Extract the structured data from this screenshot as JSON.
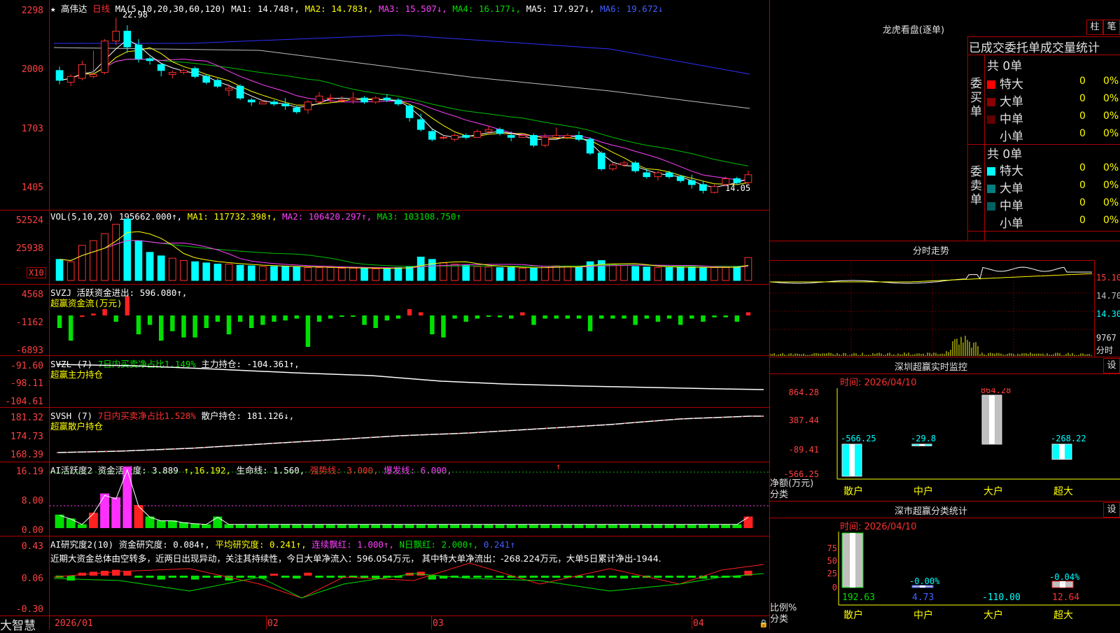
{
  "app": {
    "brand": "大智慧",
    "date_labels": [
      "2026/01",
      "02",
      "03",
      "04"
    ]
  },
  "chart_header": {
    "stock": "★ 高伟达",
    "period": "日线",
    "ma_params": "MA(5,10,20,30,60,120)",
    "ma1": "MA1: 14.748↑,",
    "ma2": "MA2: 14.783↑,",
    "ma3": "MA3: 15.507↓,",
    "ma4": "MA4: 16.177↓,",
    "ma5": "MA5: 17.927↓,",
    "ma6": "MA6: 19.672↓",
    "high_mark": "22.98",
    "low_mark": "14.05",
    "y_labels": [
      "2298",
      "2000",
      "1703",
      "1405"
    ]
  },
  "vol_panel": {
    "header_name": "VOL(5,10,20)",
    "header_value": "195662.000↑,",
    "ma1": "MA1: 117732.398↑,",
    "ma2": "MA2: 106420.297↑,",
    "ma3": "MA3: 103108.750↑",
    "y_labels": [
      "52524",
      "25938"
    ],
    "unit": "X10"
  },
  "svzj_panel": {
    "name": "SVZJ",
    "title": "活跃资金进出: 596.080↑,",
    "sub": "超赢资金流(万元)",
    "y_labels": [
      "4568",
      "-1162",
      "-6893"
    ]
  },
  "svzl_panel": {
    "name": "SVZL (7)",
    "t1": "7日内买卖净占比1.149%",
    "t2": "主力持仓: -104.361↑,",
    "sub": "超赢主力持仓",
    "y_labels": [
      "-91.60",
      "-98.11",
      "-104.61"
    ]
  },
  "svsh_panel": {
    "name": "SVSH (7)",
    "t1": "7日内买卖净占比1.528%",
    "t2": "散户持仓: 181.126↓,",
    "sub": "超赢散户持仓",
    "y_labels": [
      "181.32",
      "174.73",
      "168.39"
    ]
  },
  "ai_active": {
    "name": "AI活跃度2",
    "t1": "资金活跃度: 3.889",
    "t2": "↑,16.192,",
    "t3": "生命线: 1.560,",
    "t4": "强势线: 3.000,",
    "t5": "爆发线: 6.000,",
    "arrow": "↑",
    "y_labels": [
      "16.19",
      "8.00",
      "0.00"
    ]
  },
  "ai_research": {
    "name": "AI研究度2(10)",
    "t1": "资金研究度: 0.084↑,",
    "t2": "平均研究度: 0.241↑,",
    "t3": "连续飘红: 1.000↑,",
    "t4": "N日飘红: 2.000↑,",
    "t5": "0.241↑",
    "comment": "近期大资金总体由空转多，近两日出现异动，关注其持续性，今日大单净流入：596.054万元， 其中特大单净流出：-268.224万元，大单5日累计净出-1944.",
    "y_labels": [
      "0.43",
      "0.06",
      "-0.30"
    ]
  },
  "dragon_tiger": {
    "title": "龙虎看盘(逐单)",
    "btn1": "柱",
    "btn2": "笔",
    "stats_title": "已成交委托单成交量统计",
    "buy_label": "委买单",
    "sell_label": "委卖单",
    "buy_total": "共 0单",
    "sell_total": "共 0单",
    "buy_rows": [
      {
        "label": "特大",
        "value": "0",
        "pct": "0%",
        "color": "#ff0000"
      },
      {
        "label": "大单",
        "value": "0",
        "pct": "0%",
        "color": "#8b0000"
      },
      {
        "label": "中单",
        "value": "0",
        "pct": "0%",
        "color": "#600000"
      },
      {
        "label": "小单",
        "value": "0",
        "pct": "0%",
        "color": ""
      }
    ],
    "sell_rows": [
      {
        "label": "特大",
        "value": "0",
        "pct": "0%",
        "color": "#00ffff"
      },
      {
        "label": "大单",
        "value": "0",
        "pct": "0%",
        "color": "#008080"
      },
      {
        "label": "中单",
        "value": "0",
        "pct": "0%",
        "color": "#006060"
      },
      {
        "label": "小单",
        "value": "0",
        "pct": "0%",
        "color": ""
      }
    ]
  },
  "intraday": {
    "title": "分时走势",
    "y_labels": [
      "15.10",
      "14.70",
      "14.30",
      "9767"
    ],
    "unit": "分时"
  },
  "sz_monitor": {
    "title": "深圳超赢实时监控",
    "settings": "设",
    "time": "时间: 2026/04/10",
    "y_labels": [
      "864.28",
      "387.44",
      "-89.41",
      "-566.25"
    ],
    "ylabel": "净额(万元)",
    "xlabel": "分类",
    "categories": [
      "散户",
      "中户",
      "大户",
      "超大"
    ],
    "value_labels": [
      "-566.25",
      "-29.8",
      "864.28",
      "-268.22"
    ]
  },
  "sz_classify": {
    "title": "深市超赢分类统计",
    "settings": "设",
    "time": "时间: 2026/04/10",
    "y_labels": [
      "75",
      "50",
      "25",
      "0"
    ],
    "ylabel": "比例%",
    "xlabel": "分类",
    "categories": [
      "散户",
      "中户",
      "大户",
      "超大"
    ],
    "top_labels": [
      "",
      "-0.00%",
      "",
      "-0.04%"
    ],
    "bottom_values": [
      "192.63",
      "4.73",
      "-110.00",
      "12.64"
    ]
  },
  "colors": {
    "up": "#ff3030",
    "down": "#00ffff",
    "grid": "#b00000",
    "axis_text": "#ff4040"
  },
  "chart_data": [
    {
      "type": "candlestick",
      "title": "高伟达 日线",
      "ylabel": "",
      "ylim": [
        14.05,
        22.98
      ],
      "ohlc": [
        [
          20.3,
          20.5,
          19.6,
          19.8
        ],
        [
          19.7,
          20.1,
          19.5,
          20.0
        ],
        [
          19.9,
          20.8,
          19.8,
          20.6
        ],
        [
          20.0,
          21.3,
          19.9,
          20.1
        ],
        [
          20.2,
          21.9,
          20.1,
          21.8
        ],
        [
          21.8,
          22.98,
          21.6,
          22.3
        ],
        [
          22.3,
          22.6,
          21.2,
          21.5
        ],
        [
          21.6,
          21.9,
          20.7,
          20.9
        ],
        [
          20.9,
          21.0,
          20.6,
          20.8
        ],
        [
          20.6,
          20.7,
          20.0,
          20.3
        ],
        [
          20.1,
          20.3,
          19.9,
          20.2
        ],
        [
          20.2,
          20.4,
          20.1,
          20.3
        ],
        [
          20.4,
          20.5,
          19.9,
          20.0
        ],
        [
          20.0,
          20.1,
          19.6,
          19.7
        ],
        [
          19.8,
          19.9,
          19.4,
          19.5
        ],
        [
          19.3,
          19.6,
          19.0,
          19.4
        ],
        [
          19.5,
          19.6,
          18.8,
          18.9
        ],
        [
          18.8,
          18.9,
          18.5,
          18.7
        ],
        [
          18.6,
          18.8,
          18.6,
          18.7
        ],
        [
          18.7,
          18.8,
          18.5,
          18.6
        ],
        [
          18.6,
          18.9,
          18.3,
          18.5
        ],
        [
          18.4,
          18.5,
          18.1,
          18.2
        ],
        [
          18.3,
          18.8,
          18.1,
          18.7
        ],
        [
          18.7,
          19.2,
          18.6,
          19.0
        ],
        [
          18.9,
          19.1,
          18.7,
          18.9
        ],
        [
          18.8,
          19.0,
          18.7,
          18.8
        ],
        [
          18.8,
          19.2,
          18.6,
          18.9
        ],
        [
          18.9,
          19.0,
          18.6,
          18.7
        ],
        [
          18.7,
          19.0,
          18.6,
          18.9
        ],
        [
          18.9,
          19.1,
          18.7,
          18.8
        ],
        [
          18.8,
          18.9,
          18.5,
          18.6
        ],
        [
          18.5,
          18.6,
          17.7,
          17.9
        ],
        [
          17.8,
          18.1,
          17.2,
          17.3
        ],
        [
          17.2,
          17.3,
          16.7,
          16.8
        ],
        [
          16.9,
          17.0,
          16.8,
          16.9
        ],
        [
          16.8,
          17.1,
          16.7,
          17.0
        ],
        [
          17.0,
          17.1,
          16.8,
          16.9
        ],
        [
          16.9,
          17.3,
          16.9,
          17.2
        ],
        [
          17.2,
          17.5,
          17.1,
          17.3
        ],
        [
          17.3,
          17.4,
          17.0,
          17.1
        ],
        [
          17.0,
          17.2,
          16.7,
          16.9
        ],
        [
          16.9,
          17.0,
          16.9,
          17.0
        ],
        [
          17.0,
          17.1,
          16.4,
          16.5
        ],
        [
          16.5,
          17.1,
          16.4,
          16.9
        ],
        [
          16.9,
          17.4,
          16.9,
          17.0
        ],
        [
          16.9,
          17.1,
          16.8,
          17.0
        ],
        [
          17.0,
          17.2,
          16.7,
          16.8
        ],
        [
          16.8,
          16.9,
          16.0,
          16.1
        ],
        [
          16.1,
          16.2,
          15.2,
          15.3
        ],
        [
          15.3,
          15.6,
          15.2,
          15.5
        ],
        [
          15.5,
          15.7,
          15.4,
          15.6
        ],
        [
          15.6,
          15.7,
          15.1,
          15.2
        ],
        [
          15.1,
          15.3,
          14.8,
          14.9
        ],
        [
          14.9,
          15.2,
          14.7,
          15.1
        ],
        [
          15.1,
          15.2,
          14.8,
          14.9
        ],
        [
          14.9,
          15.0,
          14.6,
          14.7
        ],
        [
          14.7,
          15.0,
          14.3,
          14.5
        ],
        [
          14.5,
          14.7,
          14.05,
          14.2
        ],
        [
          14.1,
          14.5,
          14.05,
          14.4
        ],
        [
          14.5,
          14.9,
          14.4,
          14.8
        ],
        [
          14.8,
          14.9,
          14.5,
          14.6
        ],
        [
          14.6,
          15.2,
          14.5,
          15.0
        ]
      ]
    },
    {
      "type": "bar",
      "title": "VOL(5,10,20)",
      "ylim": [
        0,
        52524
      ],
      "values": [
        18000,
        16000,
        30000,
        34000,
        40000,
        48000,
        52524,
        34000,
        24000,
        21000,
        19000,
        17000,
        16000,
        15000,
        14000,
        14000,
        13000,
        12500,
        12000,
        12000,
        12000,
        11500,
        11000,
        11000,
        11000,
        10500,
        10500,
        10500,
        10000,
        10500,
        11000,
        12000,
        20000,
        18000,
        15000,
        14000,
        13000,
        12000,
        11500,
        11000,
        11000,
        10500,
        10500,
        12000,
        12500,
        12000,
        11500,
        16000,
        17000,
        14000,
        13000,
        12000,
        11500,
        11000,
        11000,
        11500,
        11500,
        11000,
        11000,
        11000,
        12000,
        19566
      ]
    }
  ]
}
